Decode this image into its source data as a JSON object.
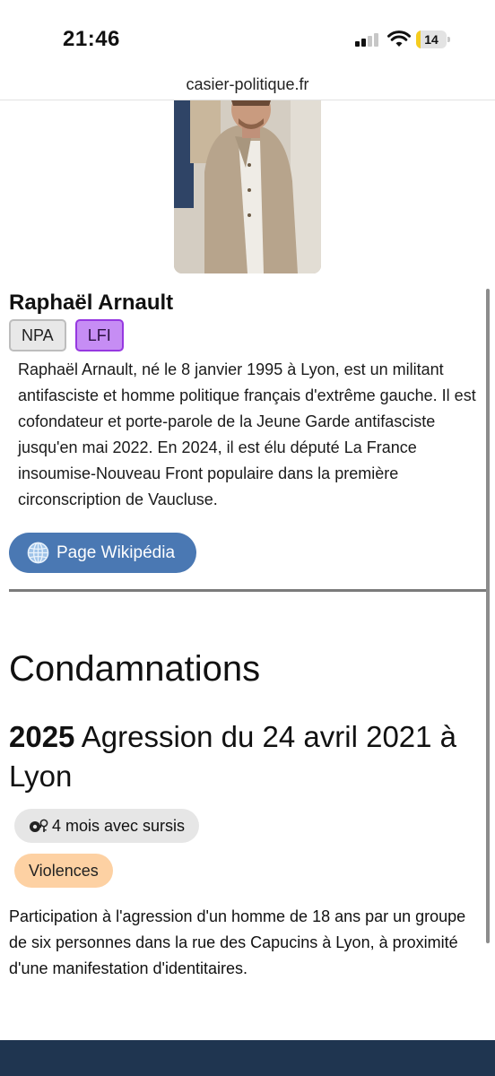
{
  "status_bar": {
    "time": "21:46",
    "battery_level": "14",
    "battery_fraction": 0.14,
    "icons": [
      "cellular-signal-icon",
      "wifi-icon",
      "battery-icon"
    ]
  },
  "browser": {
    "url": "casier-politique.fr"
  },
  "profile": {
    "photo_name": "portrait-photo",
    "name": "Raphaël Arnault",
    "parties": [
      {
        "label": "NPA",
        "color": "#e8e8e8",
        "border": "#bdbdbd"
      },
      {
        "label": "LFI",
        "color": "#c68df4",
        "border": "#9638e0"
      }
    ],
    "bio": "Raphaël Arnault, né le 8 janvier 1995 à Lyon, est un militant antifasciste et homme politique français d'extrême gauche. Il est cofondateur et porte-parole de la Jeune Garde antifasciste jusqu'en mai 2022. En 2024, il est élu député La France insoumise-Nouveau Front populaire dans la première circonscription de Vaucluse.",
    "wiki_button_label": "Page Wikipédia",
    "wiki_icon": "globe-icon",
    "wiki_button_color": "#4a78b3"
  },
  "condamnations": {
    "section_title": "Condamnations",
    "items": [
      {
        "year": "2025",
        "title": " Agression du 24 avril 2021 à Lyon",
        "sentence": "4 mois avec sursis",
        "sentence_icon": "handcuffs-icon",
        "category": "Violences",
        "category_color": "#fdd1a3",
        "description": "Participation à l'agression d'un homme de 18 ans par un groupe de six personnes dans la rue des Capucins à Lyon, à proximité d'une manifestation d'identitaires."
      }
    ]
  },
  "colors": {
    "footer": "#1f3550",
    "divider": "#7b7b7b"
  }
}
